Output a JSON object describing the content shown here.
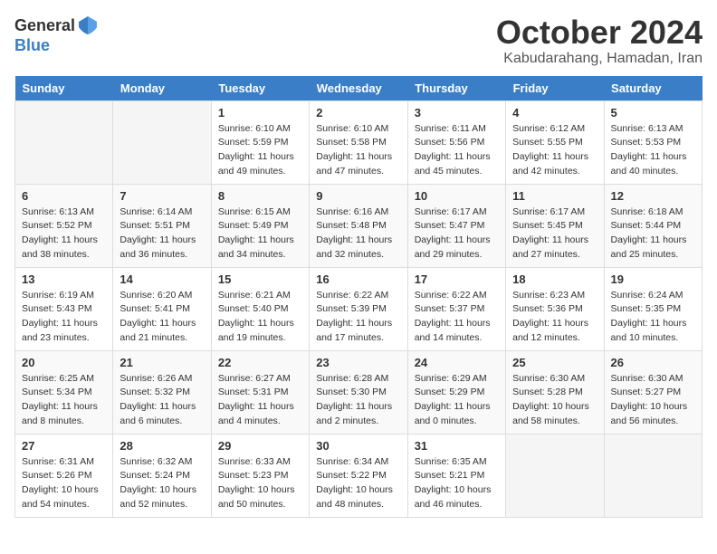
{
  "header": {
    "logo_general": "General",
    "logo_blue": "Blue",
    "month_year": "October 2024",
    "location": "Kabudarahang, Hamadan, Iran"
  },
  "calendar": {
    "days_of_week": [
      "Sunday",
      "Monday",
      "Tuesday",
      "Wednesday",
      "Thursday",
      "Friday",
      "Saturday"
    ],
    "weeks": [
      [
        {
          "day": "",
          "info": ""
        },
        {
          "day": "",
          "info": ""
        },
        {
          "day": "1",
          "info": "Sunrise: 6:10 AM\nSunset: 5:59 PM\nDaylight: 11 hours\nand 49 minutes."
        },
        {
          "day": "2",
          "info": "Sunrise: 6:10 AM\nSunset: 5:58 PM\nDaylight: 11 hours\nand 47 minutes."
        },
        {
          "day": "3",
          "info": "Sunrise: 6:11 AM\nSunset: 5:56 PM\nDaylight: 11 hours\nand 45 minutes."
        },
        {
          "day": "4",
          "info": "Sunrise: 6:12 AM\nSunset: 5:55 PM\nDaylight: 11 hours\nand 42 minutes."
        },
        {
          "day": "5",
          "info": "Sunrise: 6:13 AM\nSunset: 5:53 PM\nDaylight: 11 hours\nand 40 minutes."
        }
      ],
      [
        {
          "day": "6",
          "info": "Sunrise: 6:13 AM\nSunset: 5:52 PM\nDaylight: 11 hours\nand 38 minutes."
        },
        {
          "day": "7",
          "info": "Sunrise: 6:14 AM\nSunset: 5:51 PM\nDaylight: 11 hours\nand 36 minutes."
        },
        {
          "day": "8",
          "info": "Sunrise: 6:15 AM\nSunset: 5:49 PM\nDaylight: 11 hours\nand 34 minutes."
        },
        {
          "day": "9",
          "info": "Sunrise: 6:16 AM\nSunset: 5:48 PM\nDaylight: 11 hours\nand 32 minutes."
        },
        {
          "day": "10",
          "info": "Sunrise: 6:17 AM\nSunset: 5:47 PM\nDaylight: 11 hours\nand 29 minutes."
        },
        {
          "day": "11",
          "info": "Sunrise: 6:17 AM\nSunset: 5:45 PM\nDaylight: 11 hours\nand 27 minutes."
        },
        {
          "day": "12",
          "info": "Sunrise: 6:18 AM\nSunset: 5:44 PM\nDaylight: 11 hours\nand 25 minutes."
        }
      ],
      [
        {
          "day": "13",
          "info": "Sunrise: 6:19 AM\nSunset: 5:43 PM\nDaylight: 11 hours\nand 23 minutes."
        },
        {
          "day": "14",
          "info": "Sunrise: 6:20 AM\nSunset: 5:41 PM\nDaylight: 11 hours\nand 21 minutes."
        },
        {
          "day": "15",
          "info": "Sunrise: 6:21 AM\nSunset: 5:40 PM\nDaylight: 11 hours\nand 19 minutes."
        },
        {
          "day": "16",
          "info": "Sunrise: 6:22 AM\nSunset: 5:39 PM\nDaylight: 11 hours\nand 17 minutes."
        },
        {
          "day": "17",
          "info": "Sunrise: 6:22 AM\nSunset: 5:37 PM\nDaylight: 11 hours\nand 14 minutes."
        },
        {
          "day": "18",
          "info": "Sunrise: 6:23 AM\nSunset: 5:36 PM\nDaylight: 11 hours\nand 12 minutes."
        },
        {
          "day": "19",
          "info": "Sunrise: 6:24 AM\nSunset: 5:35 PM\nDaylight: 11 hours\nand 10 minutes."
        }
      ],
      [
        {
          "day": "20",
          "info": "Sunrise: 6:25 AM\nSunset: 5:34 PM\nDaylight: 11 hours\nand 8 minutes."
        },
        {
          "day": "21",
          "info": "Sunrise: 6:26 AM\nSunset: 5:32 PM\nDaylight: 11 hours\nand 6 minutes."
        },
        {
          "day": "22",
          "info": "Sunrise: 6:27 AM\nSunset: 5:31 PM\nDaylight: 11 hours\nand 4 minutes."
        },
        {
          "day": "23",
          "info": "Sunrise: 6:28 AM\nSunset: 5:30 PM\nDaylight: 11 hours\nand 2 minutes."
        },
        {
          "day": "24",
          "info": "Sunrise: 6:29 AM\nSunset: 5:29 PM\nDaylight: 11 hours\nand 0 minutes."
        },
        {
          "day": "25",
          "info": "Sunrise: 6:30 AM\nSunset: 5:28 PM\nDaylight: 10 hours\nand 58 minutes."
        },
        {
          "day": "26",
          "info": "Sunrise: 6:30 AM\nSunset: 5:27 PM\nDaylight: 10 hours\nand 56 minutes."
        }
      ],
      [
        {
          "day": "27",
          "info": "Sunrise: 6:31 AM\nSunset: 5:26 PM\nDaylight: 10 hours\nand 54 minutes."
        },
        {
          "day": "28",
          "info": "Sunrise: 6:32 AM\nSunset: 5:24 PM\nDaylight: 10 hours\nand 52 minutes."
        },
        {
          "day": "29",
          "info": "Sunrise: 6:33 AM\nSunset: 5:23 PM\nDaylight: 10 hours\nand 50 minutes."
        },
        {
          "day": "30",
          "info": "Sunrise: 6:34 AM\nSunset: 5:22 PM\nDaylight: 10 hours\nand 48 minutes."
        },
        {
          "day": "31",
          "info": "Sunrise: 6:35 AM\nSunset: 5:21 PM\nDaylight: 10 hours\nand 46 minutes."
        },
        {
          "day": "",
          "info": ""
        },
        {
          "day": "",
          "info": ""
        }
      ]
    ]
  }
}
